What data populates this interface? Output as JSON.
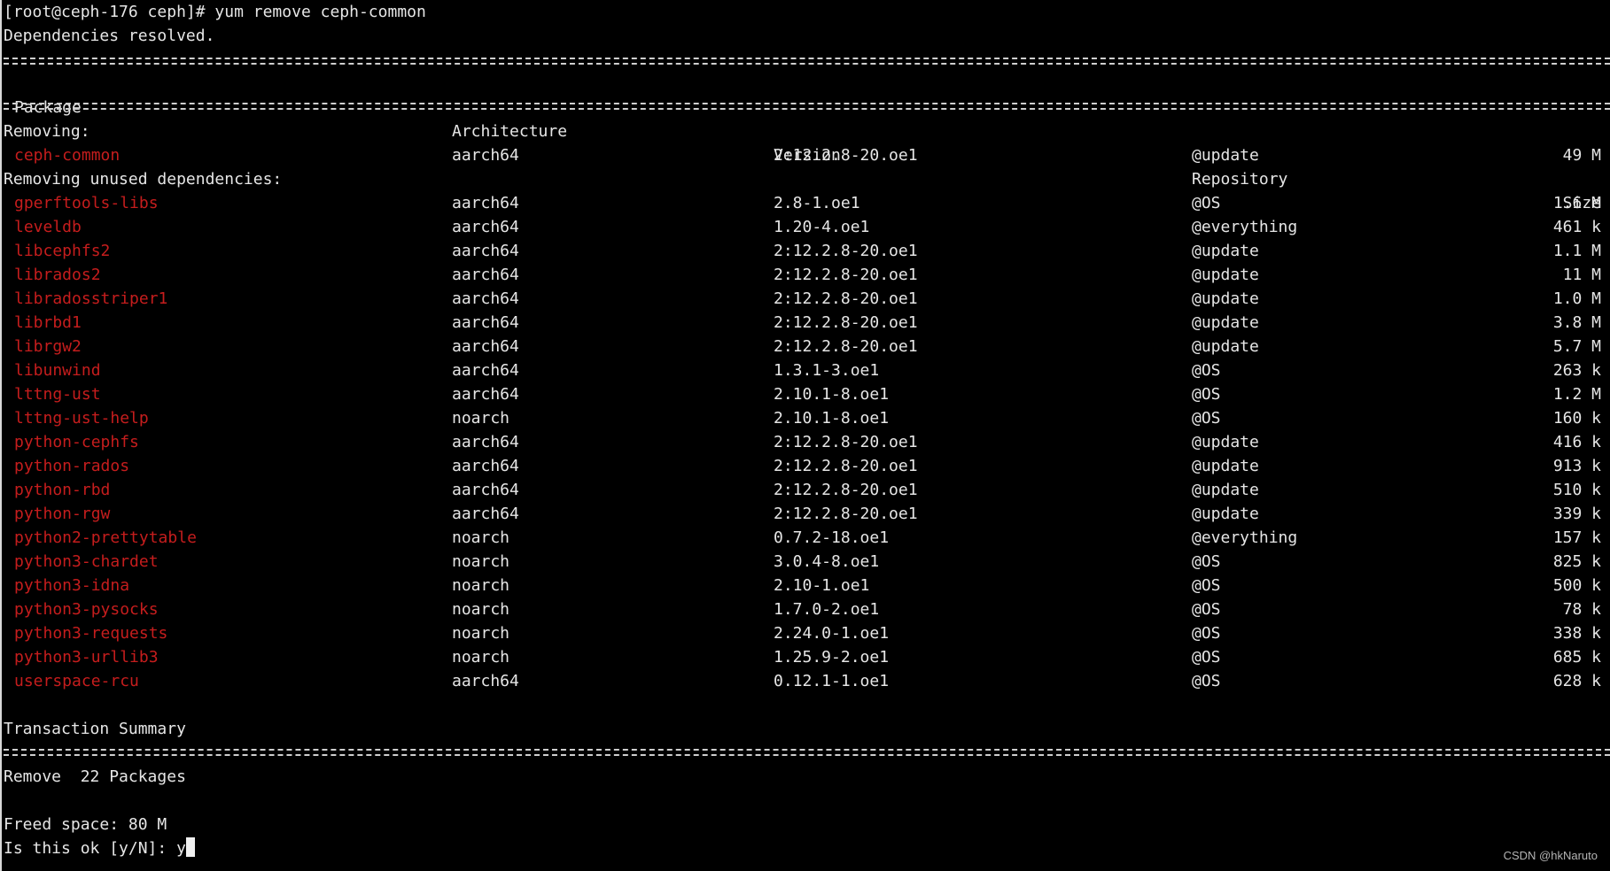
{
  "terminal": {
    "prompt_line": "[root@ceph-176 ceph]# yum remove ceph-common",
    "resolved": "Dependencies resolved.",
    "headers": {
      "package": "Package",
      "architecture": "Architecture",
      "version": "Version",
      "repository": "Repository",
      "size": "Size"
    },
    "removing_label": "Removing:",
    "removing": [
      {
        "package": "ceph-common",
        "arch": "aarch64",
        "version": "2:12.2.8-20.oe1",
        "repo": "@update",
        "size": "49 M"
      }
    ],
    "unused_label": "Removing unused dependencies:",
    "unused": [
      {
        "package": "gperftools-libs",
        "arch": "aarch64",
        "version": "2.8-1.oe1",
        "repo": "@OS",
        "size": "1.6 M"
      },
      {
        "package": "leveldb",
        "arch": "aarch64",
        "version": "1.20-4.oe1",
        "repo": "@everything",
        "size": "461 k"
      },
      {
        "package": "libcephfs2",
        "arch": "aarch64",
        "version": "2:12.2.8-20.oe1",
        "repo": "@update",
        "size": "1.1 M"
      },
      {
        "package": "librados2",
        "arch": "aarch64",
        "version": "2:12.2.8-20.oe1",
        "repo": "@update",
        "size": "11 M"
      },
      {
        "package": "libradosstriper1",
        "arch": "aarch64",
        "version": "2:12.2.8-20.oe1",
        "repo": "@update",
        "size": "1.0 M"
      },
      {
        "package": "librbd1",
        "arch": "aarch64",
        "version": "2:12.2.8-20.oe1",
        "repo": "@update",
        "size": "3.8 M"
      },
      {
        "package": "librgw2",
        "arch": "aarch64",
        "version": "2:12.2.8-20.oe1",
        "repo": "@update",
        "size": "5.7 M"
      },
      {
        "package": "libunwind",
        "arch": "aarch64",
        "version": "1.3.1-3.oe1",
        "repo": "@OS",
        "size": "263 k"
      },
      {
        "package": "lttng-ust",
        "arch": "aarch64",
        "version": "2.10.1-8.oe1",
        "repo": "@OS",
        "size": "1.2 M"
      },
      {
        "package": "lttng-ust-help",
        "arch": "noarch",
        "version": "2.10.1-8.oe1",
        "repo": "@OS",
        "size": "160 k"
      },
      {
        "package": "python-cephfs",
        "arch": "aarch64",
        "version": "2:12.2.8-20.oe1",
        "repo": "@update",
        "size": "416 k"
      },
      {
        "package": "python-rados",
        "arch": "aarch64",
        "version": "2:12.2.8-20.oe1",
        "repo": "@update",
        "size": "913 k"
      },
      {
        "package": "python-rbd",
        "arch": "aarch64",
        "version": "2:12.2.8-20.oe1",
        "repo": "@update",
        "size": "510 k"
      },
      {
        "package": "python-rgw",
        "arch": "aarch64",
        "version": "2:12.2.8-20.oe1",
        "repo": "@update",
        "size": "339 k"
      },
      {
        "package": "python2-prettytable",
        "arch": "noarch",
        "version": "0.7.2-18.oe1",
        "repo": "@everything",
        "size": "157 k"
      },
      {
        "package": "python3-chardet",
        "arch": "noarch",
        "version": "3.0.4-8.oe1",
        "repo": "@OS",
        "size": "825 k"
      },
      {
        "package": "python3-idna",
        "arch": "noarch",
        "version": "2.10-1.oe1",
        "repo": "@OS",
        "size": "500 k"
      },
      {
        "package": "python3-pysocks",
        "arch": "noarch",
        "version": "1.7.0-2.oe1",
        "repo": "@OS",
        "size": "78 k"
      },
      {
        "package": "python3-requests",
        "arch": "noarch",
        "version": "2.24.0-1.oe1",
        "repo": "@OS",
        "size": "338 k"
      },
      {
        "package": "python3-urllib3",
        "arch": "noarch",
        "version": "1.25.9-2.oe1",
        "repo": "@OS",
        "size": "685 k"
      },
      {
        "package": "userspace-rcu",
        "arch": "aarch64",
        "version": "0.12.1-1.oe1",
        "repo": "@OS",
        "size": "628 k"
      }
    ],
    "summary_title": "Transaction Summary",
    "summary_remove": "Remove  22 Packages",
    "freed_space": "Freed space: 80 M",
    "confirm_prompt": "Is this ok [y/N]: ",
    "confirm_input": "y"
  },
  "watermark": "CSDN @hkNaruto",
  "colors": {
    "background": "#000000",
    "text": "#e6e6e6",
    "package_name": "#c51d1d"
  }
}
